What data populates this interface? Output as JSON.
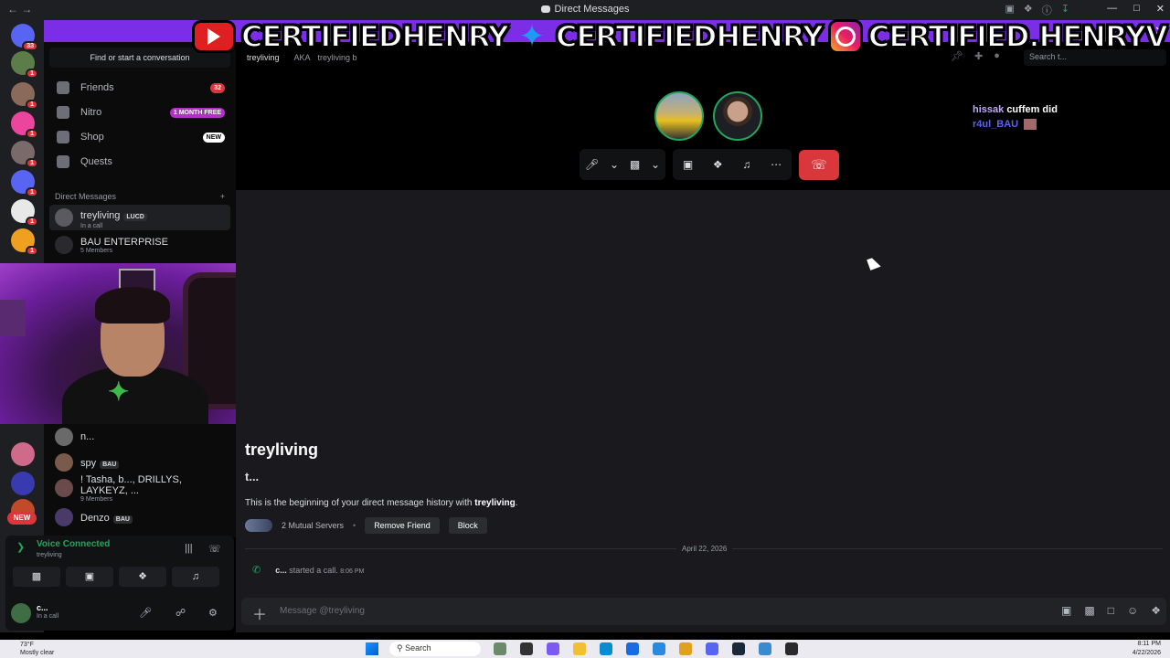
{
  "window": {
    "title": "Direct Messages",
    "nav_arrows": "←  →"
  },
  "banner": {
    "youtube_handle": "CERTIFIEDHENRY",
    "twitter_handle": "CERTIFIEDHENRY",
    "instagram_handle": "CERTIFIED.HENRYV",
    "close": "✕"
  },
  "server_rail": {
    "home_badge": "33",
    "new_label": "NEW"
  },
  "sidebar": {
    "search_label": "Find or start a conversation",
    "nav": [
      {
        "label": "Friends",
        "pill": "32",
        "pill_color": "#da373c"
      },
      {
        "label": "Nitro",
        "pill": "1 MONTH FREE",
        "pill_color": "#b42fc8"
      },
      {
        "label": "Shop",
        "pill": "NEW",
        "pill_color": "#5865f2"
      },
      {
        "label": "Quests",
        "pill": "",
        "pill_color": ""
      }
    ],
    "dm_header": "Direct Messages",
    "dm_add": "+",
    "dms": [
      {
        "name": "treyliving",
        "tag": "LUCD",
        "sub": "In a call"
      },
      {
        "name": "BAU ENTERPRISE",
        "tag": "",
        "sub": "5 Members"
      }
    ],
    "lower_dms": [
      {
        "name": "n...",
        "tag": "",
        "sub": ""
      },
      {
        "name": "spy",
        "tag": "BAU",
        "sub": ""
      },
      {
        "name": "! Tasha, b..., DRILLYS, LAYKEYZ, ...",
        "tag": "",
        "sub": "9 Members"
      },
      {
        "name": "Denzo",
        "tag": "BAU",
        "sub": ""
      }
    ]
  },
  "voice": {
    "status": "Voice Connected",
    "channel": "treyliving"
  },
  "user": {
    "name": "c...",
    "status": "In a call"
  },
  "header": {
    "dm_name": "treyliving",
    "aka_label": "AKA",
    "aka_name": "treyliving b",
    "search_placeholder": "Search t..."
  },
  "call_overlay": {
    "user1": "hissak",
    "msg1": "cuffem did",
    "user2": "r4ul_BAU"
  },
  "chat": {
    "intro_name": "treyliving",
    "intro_user": "t...",
    "intro_text": "This is the beginning of your direct message history with ",
    "intro_bold": "treyliving",
    "intro_end": ".",
    "mutual_servers": "2 Mutual Servers",
    "remove_friend": "Remove Friend",
    "block": "Block",
    "date": "April 22, 2026",
    "call_user": "c...",
    "call_text": " started a call.",
    "call_time": "8:06 PM",
    "composer_placeholder": "Message @treyliving"
  },
  "taskbar": {
    "temp": "73°F",
    "weather": "Mostly clear",
    "search": "Search",
    "time": "8:11 PM",
    "date": "4/22/2026"
  }
}
